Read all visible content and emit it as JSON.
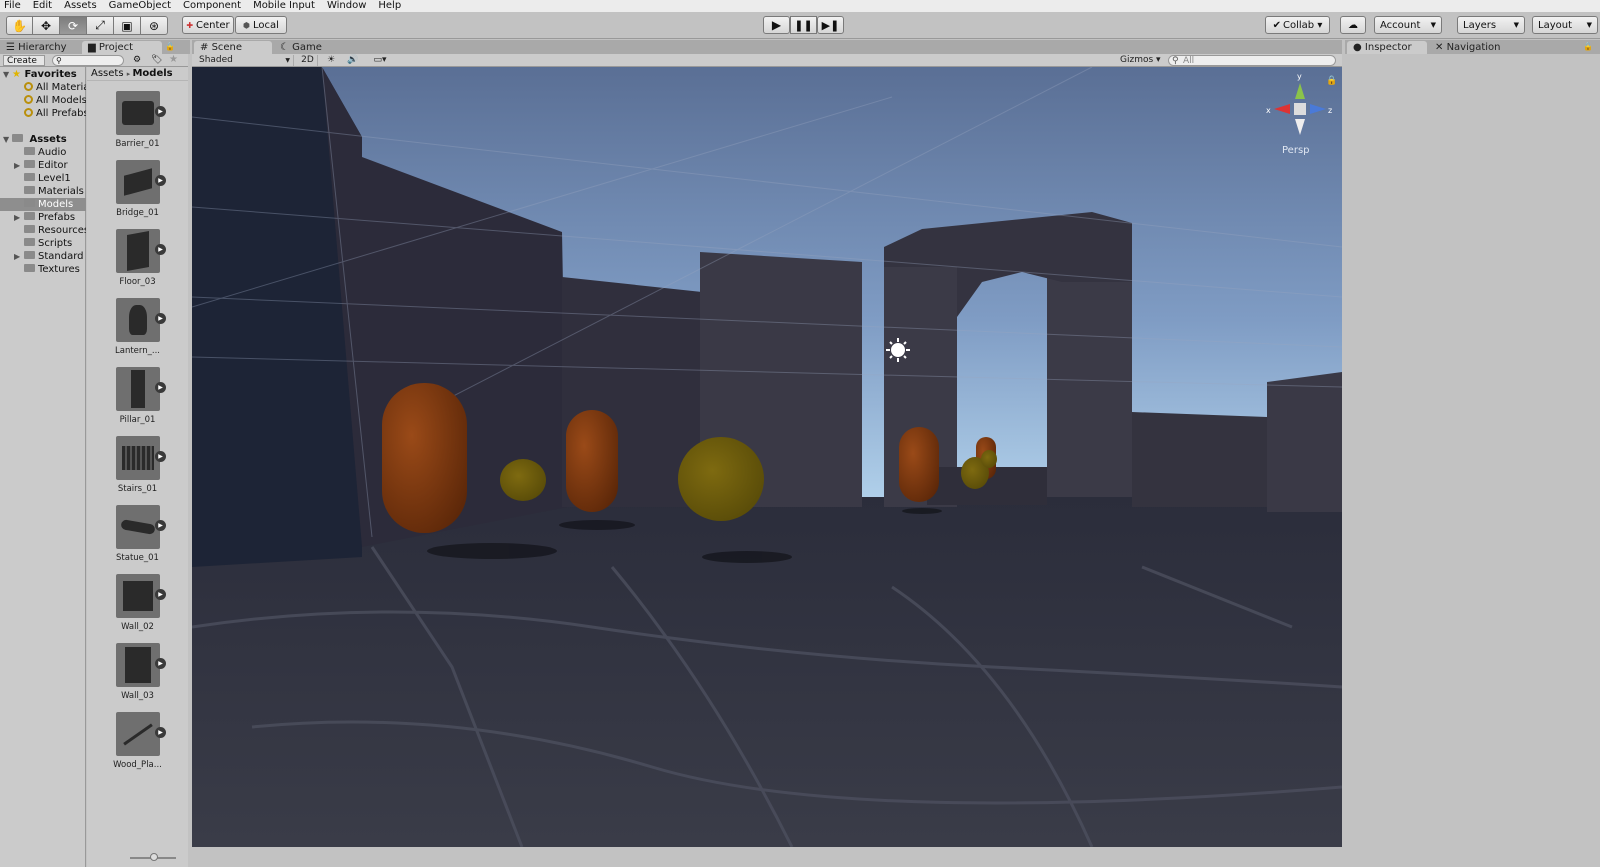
{
  "menu": [
    "File",
    "Edit",
    "Assets",
    "GameObject",
    "Component",
    "Mobile Input",
    "Window",
    "Help"
  ],
  "toolbar": {
    "pivot": "Center",
    "space": "Local",
    "collab": "Collab ▾",
    "account": "Account",
    "layers": "Layers",
    "layout": "Layout"
  },
  "tabs": {
    "hierarchy": "Hierarchy",
    "project": "Project",
    "scene": "Scene",
    "game": "Game",
    "inspector": "Inspector",
    "navigation": "Navigation"
  },
  "project": {
    "create": "Create ▾",
    "breadcrumb_root": "Assets",
    "breadcrumb_current": "Models",
    "favorites_label": "Favorites",
    "favorites": [
      "All Materia",
      "All Models",
      "All Prefabs"
    ],
    "assets_label": "Assets",
    "folders": [
      "Audio",
      "Editor",
      "Level1",
      "Materials",
      "Models",
      "Prefabs",
      "Resources",
      "Scripts",
      "Standard A",
      "Textures"
    ],
    "selected_folder": "Models",
    "items": [
      "Barrier_01",
      "Bridge_01",
      "Floor_03",
      "Lantern_...",
      "Pillar_01",
      "Stairs_01",
      "Statue_01",
      "Wall_02",
      "Wall_03",
      "Wood_Pla..."
    ]
  },
  "scene": {
    "shading": "Shaded",
    "mode_2d": "2D",
    "gizmos": "Gizmos ▾",
    "search_placeholder": "All",
    "persp": "Persp"
  },
  "colors": {
    "sky_top": "#5a6f95",
    "sky_horizon": "#b8d8f0",
    "capsule": "#7a3610",
    "cylinder": "#6f5d0c"
  }
}
